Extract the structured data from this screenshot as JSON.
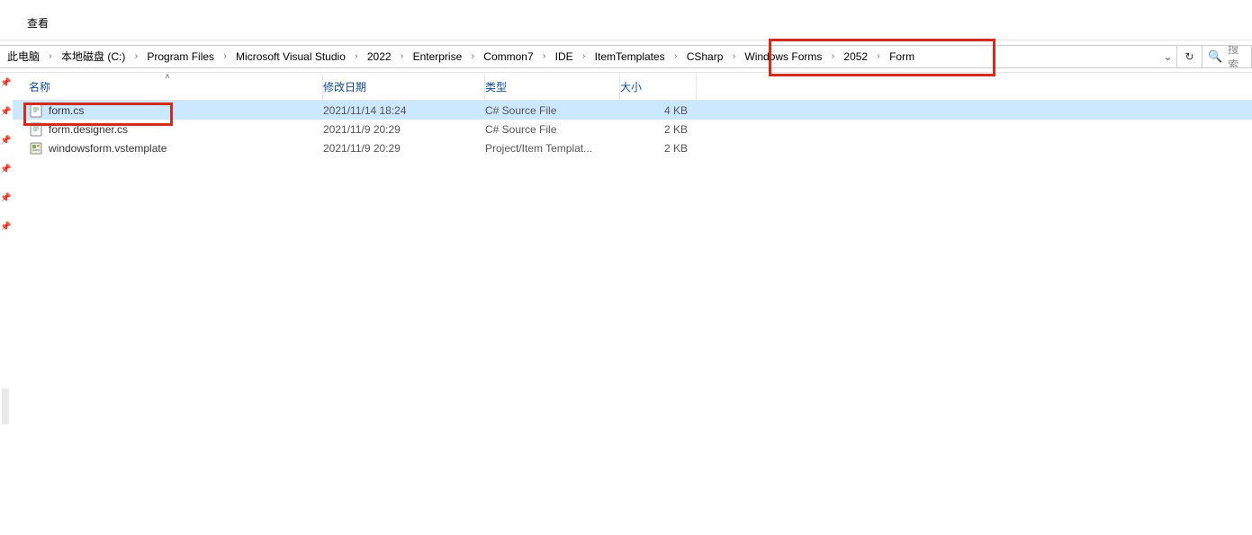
{
  "tabs": {
    "view": "查看"
  },
  "breadcrumb": {
    "items": [
      "此电脑",
      "本地磁盘 (C:)",
      "Program Files",
      "Microsoft Visual Studio",
      "2022",
      "Enterprise",
      "Common7",
      "IDE",
      "ItemTemplates",
      "CSharp",
      "Windows Forms",
      "2052",
      "Form"
    ]
  },
  "search": {
    "placeholder": "搜索"
  },
  "columns": {
    "name": "名称",
    "date": "修改日期",
    "type": "类型",
    "size": "大小"
  },
  "rows": [
    {
      "name": "form.cs",
      "date": "2021/11/14 18:24",
      "type": "C# Source File",
      "size": "4 KB",
      "icon": "code",
      "selected": true
    },
    {
      "name": "form.designer.cs",
      "date": "2021/11/9 20:29",
      "type": "C# Source File",
      "size": "2 KB",
      "icon": "code",
      "selected": false
    },
    {
      "name": "windowsform.vstemplate",
      "date": "2021/11/9 20:29",
      "type": "Project/Item Templat...",
      "size": "2 KB",
      "icon": "template",
      "selected": false
    }
  ]
}
